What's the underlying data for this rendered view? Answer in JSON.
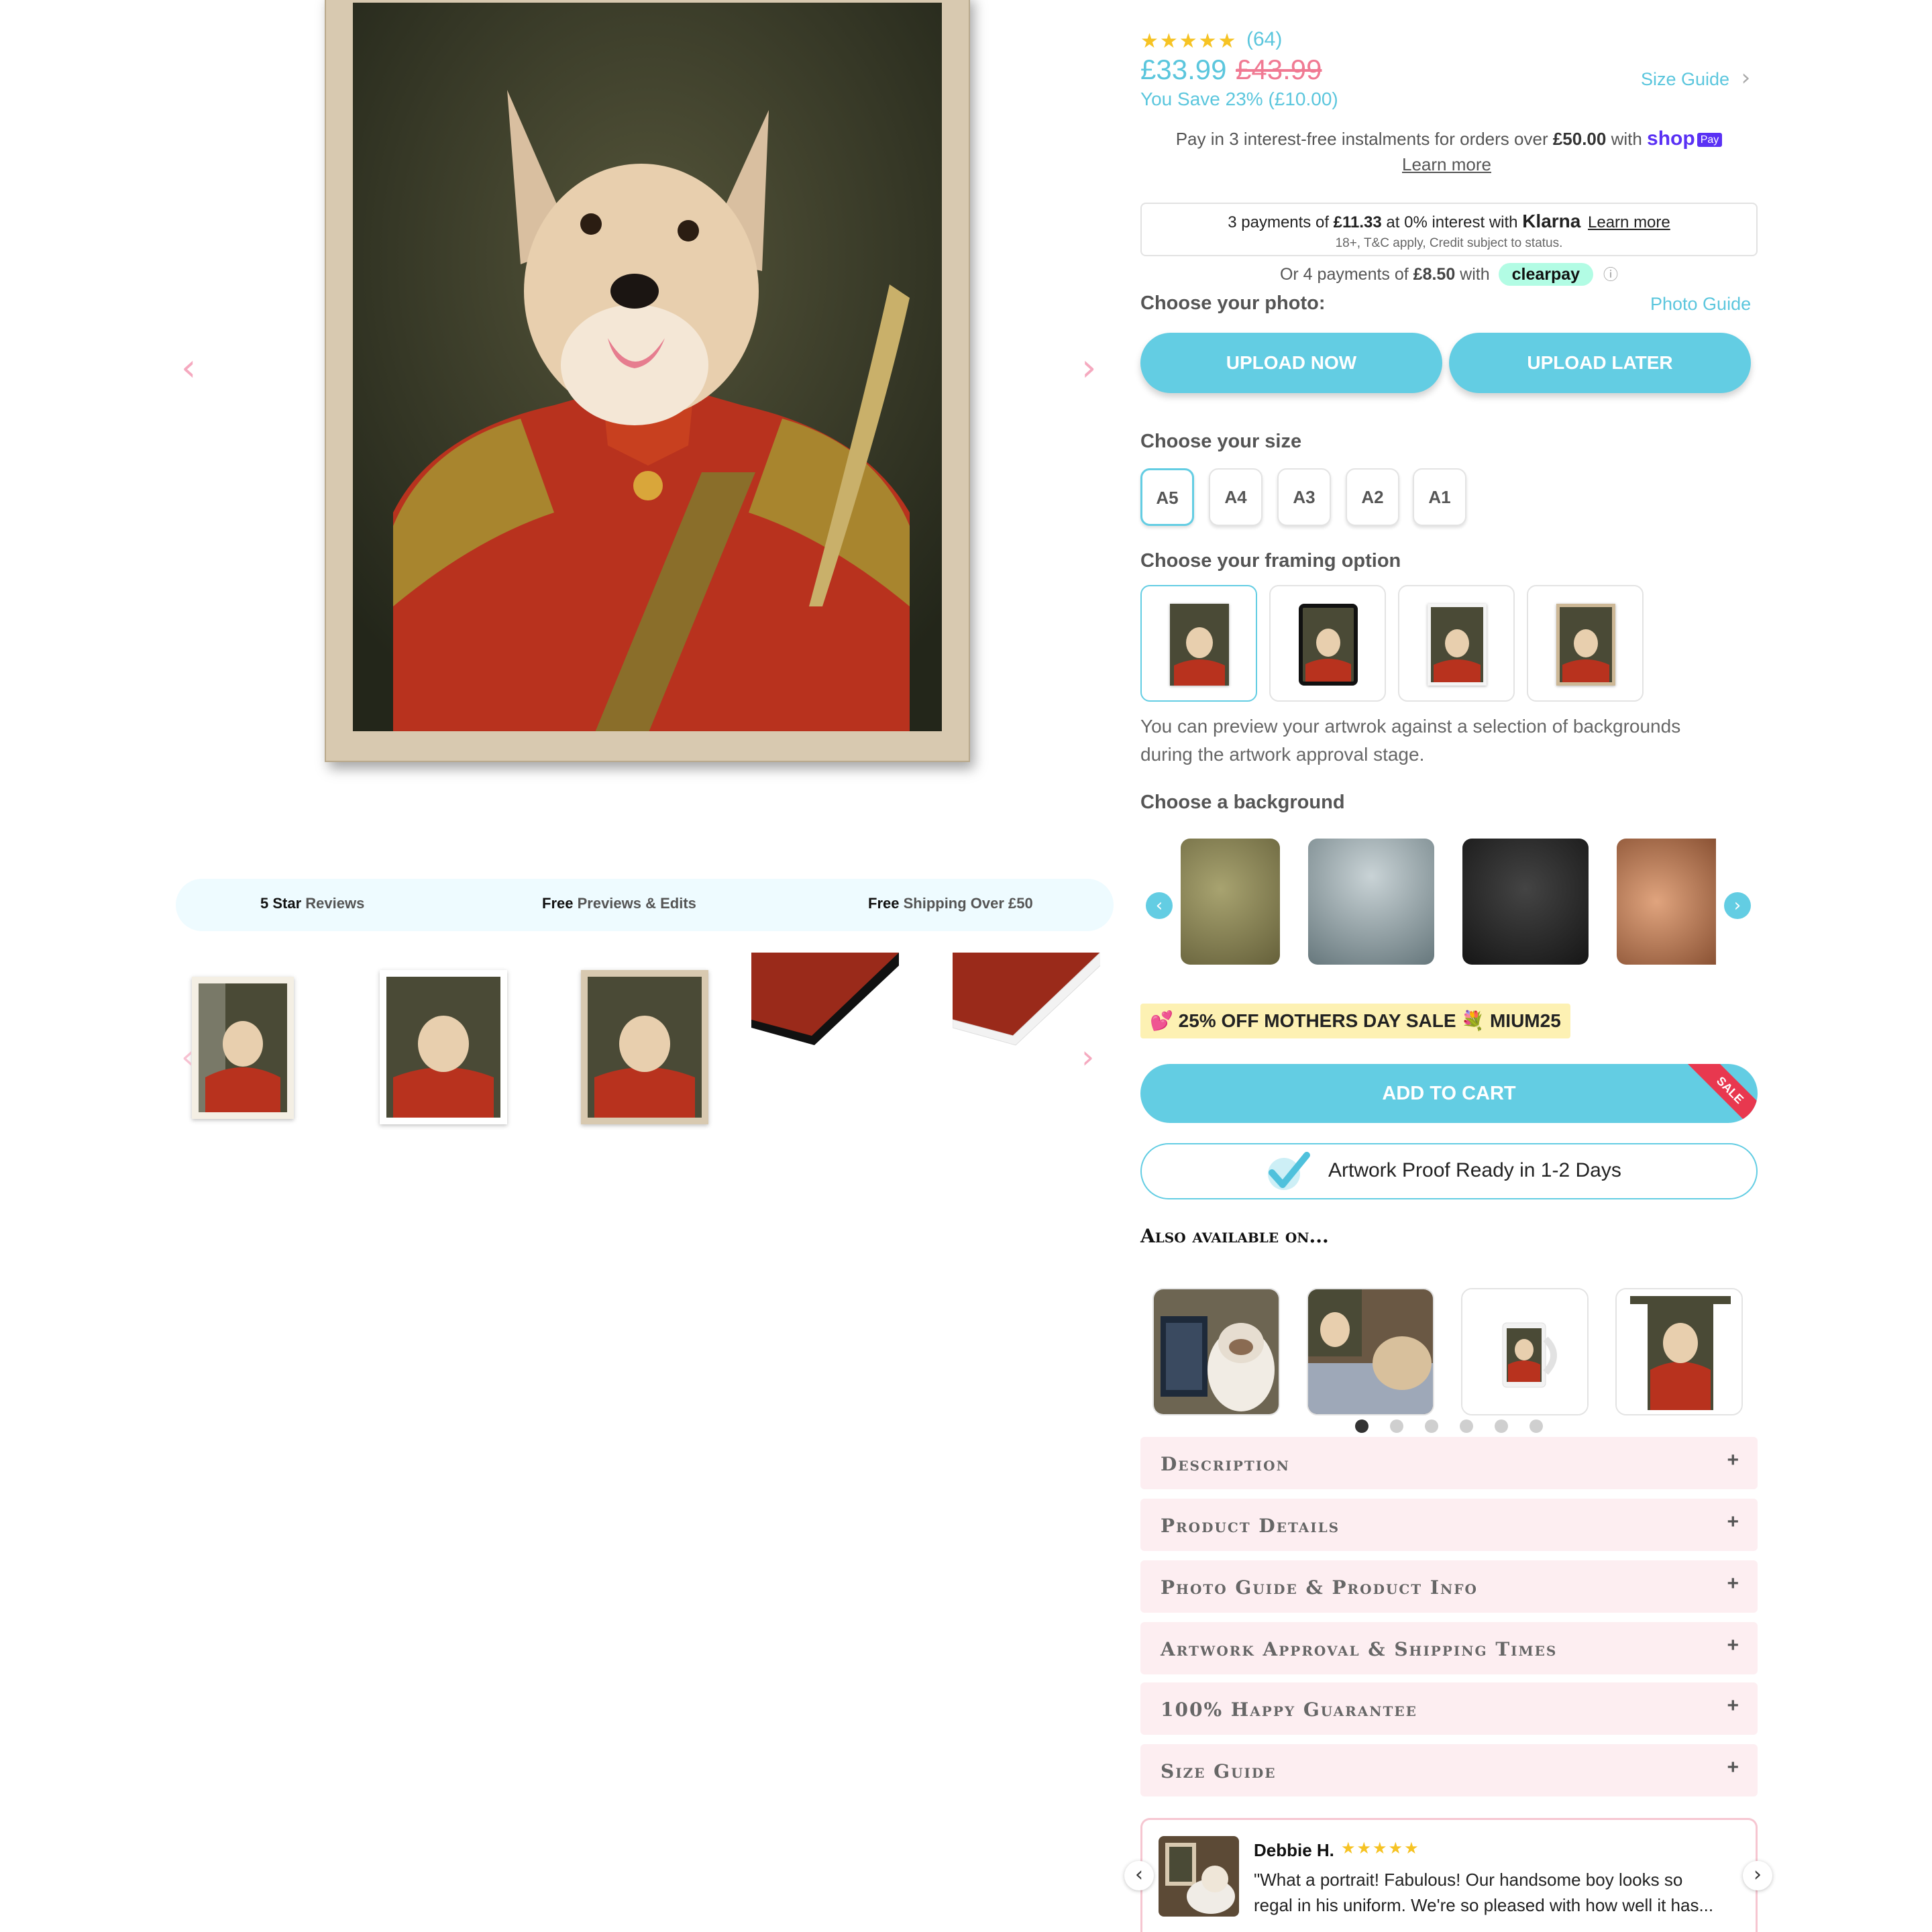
{
  "gallery": {
    "prev_arrow": "‹",
    "next_arrow": "›",
    "trust_badges": [
      {
        "bold": "5 Star",
        "rest": " Reviews"
      },
      {
        "bold": "Free",
        "rest": " Previews & Edits"
      },
      {
        "bold": "Free",
        "rest": " Shipping Over £50"
      }
    ]
  },
  "product": {
    "stars": "★★★★★",
    "review_count": "(64)",
    "price": "£33.99",
    "compare_price": "£43.99",
    "savings": "You Save 23% (£10.00)",
    "size_guide_link": "Size Guide",
    "size_guide_chevron": "›"
  },
  "shop_pay": {
    "text_pre": "Pay in 3 interest-free instalments for orders over ",
    "amount": "£50.00",
    "text_post": " with ",
    "brand": "shop",
    "badge": "Pay",
    "learn_more": "Learn more"
  },
  "klarna": {
    "pre": "3 payments of ",
    "amount": "£11.33",
    "mid": " at 0% interest with ",
    "brand": "Klarna",
    "learn_more": "Learn more",
    "fine_print": "18+, T&C apply, Credit subject to status."
  },
  "clearpay": {
    "pre": "Or 4 payments of ",
    "amount": "£8.50",
    "post": " with",
    "brand": "clearpay",
    "info": "ⓘ"
  },
  "photo": {
    "heading": "Choose your photo:",
    "guide_link": "Photo Guide",
    "upload_now": "UPLOAD NOW",
    "upload_later": "UPLOAD LATER"
  },
  "size": {
    "heading": "Choose your size",
    "options": [
      "A5",
      "A4",
      "A3",
      "A2",
      "A1"
    ],
    "selected": "A5"
  },
  "framing": {
    "heading": "Choose your framing option",
    "note": "You can preview your artwrok against a selection of backgrounds during the artwork approval stage."
  },
  "background": {
    "heading": "Choose a background",
    "prev": "‹",
    "next": "›"
  },
  "promo": {
    "emoji_left": "💕",
    "text": "25% OFF MOTHERS DAY SALE",
    "emoji_mid": "💐",
    "code": "MIUM25"
  },
  "cart": {
    "add_to_cart": "ADD TO CART",
    "sale_ribbon": "SALE",
    "proof": "Artwork Proof Ready in 1-2 Days"
  },
  "also_available": {
    "heading": "Also available on...",
    "active_dot": 0
  },
  "accordion": [
    {
      "title": "Description",
      "icon": "+"
    },
    {
      "title": "Product Details",
      "icon": "+"
    },
    {
      "title": "Photo Guide & Product Info",
      "icon": "+"
    },
    {
      "title": "Artwork Approval & Shipping Times",
      "icon": "+"
    },
    {
      "title": "100% Happy Guarantee",
      "icon": "+"
    },
    {
      "title": "Size Guide",
      "icon": "+"
    }
  ],
  "review": {
    "name": "Debbie H.",
    "stars": "★★★★★",
    "text_line1": "\"What a portrait! Fabulous! Our handsome boy looks so",
    "text_line2": "regal in his uniform. We're so pleased with how well it has...",
    "prev": "‹",
    "next": "›"
  },
  "colors": {
    "accent": "#63cde3",
    "price": "#5bc6dd",
    "compare_price": "#f07a93",
    "promo_bg": "#fdf1b3",
    "accordion_bg": "#fdeef1",
    "star": "#f6c324"
  }
}
